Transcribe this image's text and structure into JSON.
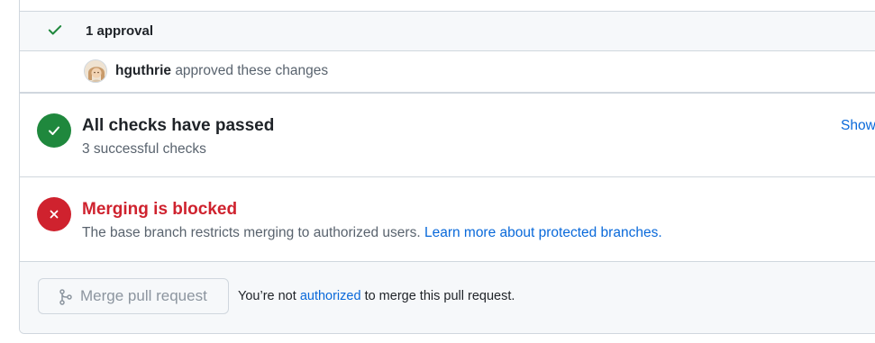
{
  "approval": {
    "summary": "1 approval",
    "reviewer_name": "hguthrie",
    "reviewer_action": "approved these changes"
  },
  "checks": {
    "title": "All checks have passed",
    "subtitle": "3 successful checks",
    "show_link": "Show all checks",
    "status_color": "#1f883d"
  },
  "blocked": {
    "title": "Merging is blocked",
    "description": "The base branch restricts merging to authorized users.",
    "link_text": "Learn more about protected branches.",
    "status_color": "#cf222e"
  },
  "merge": {
    "button_label": "Merge pull request",
    "note_prefix": "You’re not",
    "note_link": "authorized",
    "note_suffix": "to merge this pull request."
  },
  "icons": {
    "approval": "check-icon",
    "checks": "check-circle-icon",
    "blocked": "x-circle-icon",
    "merge": "git-merge-icon"
  },
  "colors": {
    "link": "#0969da",
    "success": "#1f883d",
    "danger": "#cf222e",
    "border": "#d0d7de",
    "muted": "#59636e"
  }
}
